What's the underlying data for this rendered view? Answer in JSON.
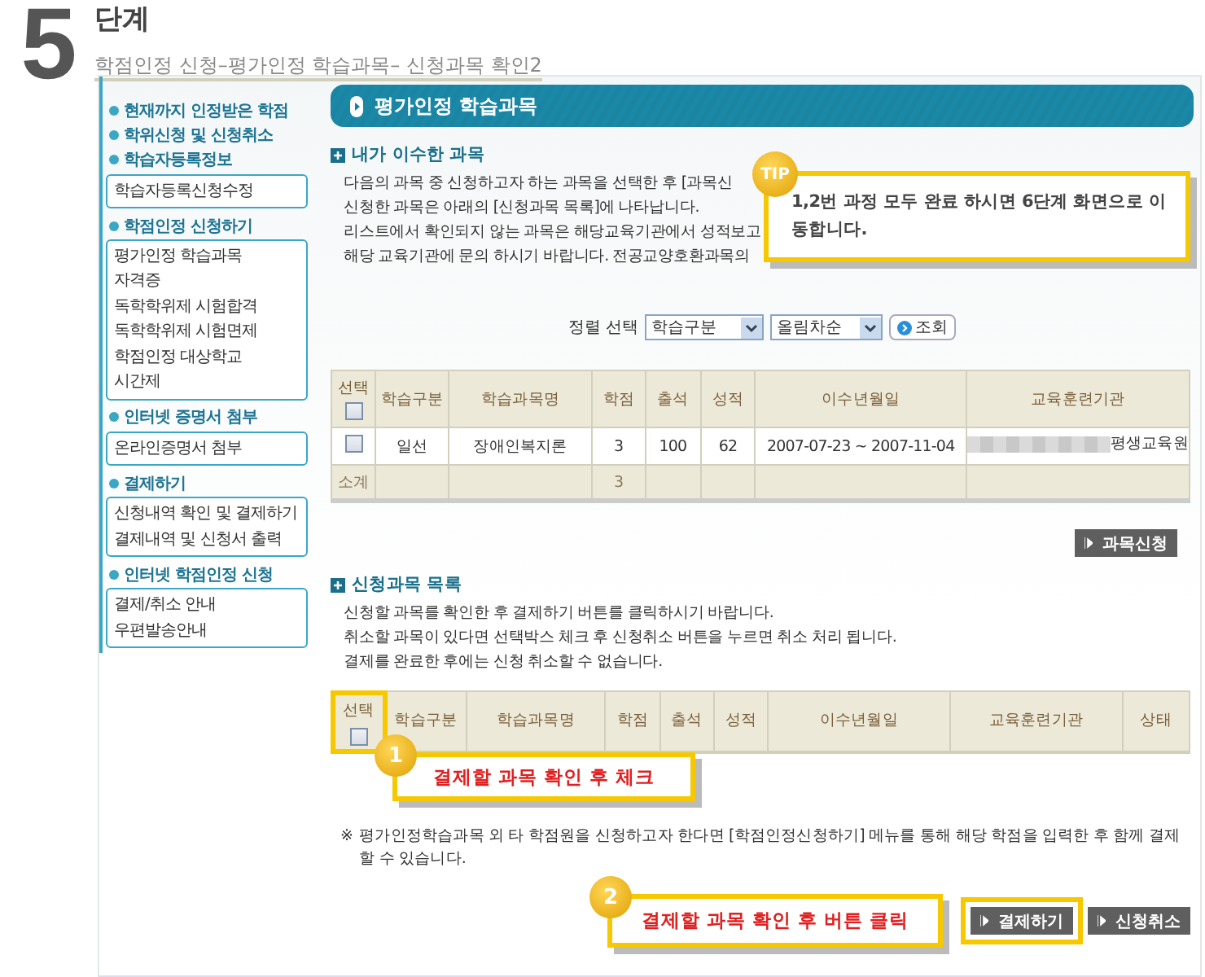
{
  "step": {
    "number": "5",
    "title": "단계",
    "subtitle": "학점인정 신청–평가인정 학습과목– 신청과목 확인2"
  },
  "sidebar": {
    "sections": [
      {
        "title": "현재까지 인정받은 학점"
      },
      {
        "title": "학위신청 및 신청취소"
      },
      {
        "title": "학습자등록정보",
        "items": [
          "학습자등록신청수정"
        ]
      },
      {
        "title": "학점인정 신청하기",
        "items": [
          "평가인정 학습과목",
          "자격증",
          "독학학위제 시험합격",
          "독학학위제 시험면제",
          "학점인정 대상학교",
          "시간제"
        ]
      },
      {
        "title": "인터넷 증명서 첨부",
        "items": [
          "온라인증명서 첨부"
        ]
      },
      {
        "title": "결제하기",
        "items": [
          "신청내역 확인 및 결제하기",
          "결제내역 및 신청서 출력"
        ]
      },
      {
        "title": "인터넷 학점인정 신청",
        "items": [
          "결제/취소 안내",
          "우편발송안내"
        ]
      }
    ]
  },
  "page_title": "평가인정 학습과목",
  "completed": {
    "title": "내가 이수한 과목",
    "lines": [
      "다음의 과목 중 신청하고자 하는 과목을 선택한 후 [과목신",
      "신청한 과목은 아래의 [신청과목 목록]에 나타납니다.",
      "리스트에서 확인되지 않는 과목은 해당교육기관에서 성적보고",
      "해당 교육기관에 문의 하시기 바랍니다. 전공교양호환과목의"
    ],
    "sort": {
      "label": "정렬 선택",
      "field": "학습구분",
      "order": "올림차순",
      "button": "조회"
    },
    "table": {
      "columns": [
        "선택",
        "학습구분",
        "학습과목명",
        "학점",
        "출석",
        "성적",
        "이수년월일",
        "교육훈련기관"
      ],
      "header_checked": false,
      "rows": [
        {
          "checked": false,
          "cells": [
            "",
            "일선",
            "장애인복지론",
            "3",
            "100",
            "62",
            "2007-07-23 ~ 2007-11-04",
            "평생교육원"
          ]
        }
      ],
      "subtotal": {
        "label": "소계",
        "credits": "3"
      }
    },
    "button": "과목신청"
  },
  "applied": {
    "title": "신청과목 목록",
    "lines": [
      "신청할 과목를 확인한 후 결제하기 버튼를 클릭하시기 바랍니다.",
      "취소할 과목이 있다면 선택박스 체크 후 신청취소 버튼을 누르면 취소 처리 됩니다.",
      "결제를 완료한 후에는 신청 취소할 수 없습니다."
    ],
    "table": {
      "columns": [
        "선택",
        "학습구분",
        "학습과목명",
        "학점",
        "출석",
        "성적",
        "이수년월일",
        "교육훈련기관",
        "상태"
      ],
      "header_checked": false
    },
    "note_mark": "※",
    "note": "평가인정학습과목 외 타 학점원을 신청하고자 한다면 [학점인정신청하기] 메뉴를 통해 해당 학점을 입력한 후 함께 결제할 수 있습니다.",
    "buttons": [
      "결제하기",
      "신청취소"
    ]
  },
  "tip": {
    "badge": "TIP",
    "text": "1,2번 과정 모두 완료 하시면 6단계 화면으로 이동합니다."
  },
  "callouts": [
    {
      "number": "1",
      "text": "결제할 과목 확인 후 체크"
    },
    {
      "number": "2",
      "text": "결제할 과목 확인 후 버튼 클릭"
    }
  ]
}
